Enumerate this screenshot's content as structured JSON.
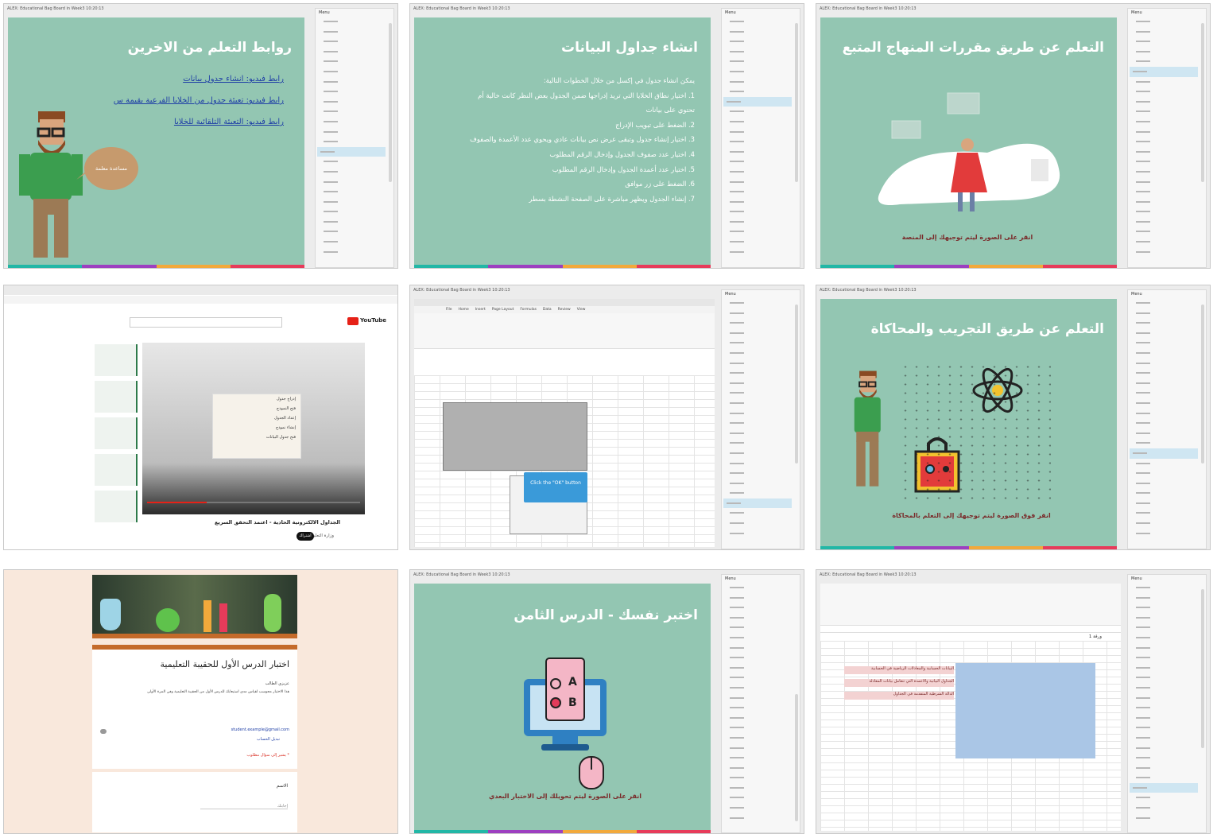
{
  "window_title": "ALEX: Educational Bag Board in Week3 10:20:13",
  "menu_label": "Menu",
  "colors": {
    "slide_bg": "#93c6b2",
    "stripe": [
      "#22b7a6",
      "#9d3fc0",
      "#f2a93b",
      "#e73b5a"
    ],
    "link": "#1f3fa6",
    "caption": "#7a2a2a",
    "sheet_highlight": "#aac6e6",
    "form_bg": "#f9e8dc"
  },
  "tiles": {
    "t1": {
      "title": "روابط التعلم من الاخرين",
      "links": [
        "رابط فيديو: انشاء جدول بيانات",
        "رابط فيديو: تعبئة جدول من الخلايا الفرعية بقيمة س",
        "رابط فيديو: التعبئة التلقائية للخلايا"
      ],
      "bubble": "مساعدة معلمة",
      "icons": [
        "teacher-character-icon",
        "speech-bubble-icon"
      ]
    },
    "t2": {
      "title": "انشاء جداول البيانات",
      "intro": "يمكن انشاء جدول في إكسل من خلال الخطوات التالية:",
      "steps": [
        "1. اختيار نطاق الخلايا التي تريد إدراجها ضمن الجدول بعض النظر كانت خالية أم",
        "تحتوي على بيانات",
        "2. الضغط على تبويب الإدراج",
        "3. اختيار إنشاء جدول وتبقى عرض نص بيانات عادي ويحوي عدد الأعمدة والصفوف",
        "4. اختيار عدد صفوف الجدول وإدخال الرقم المطلوب",
        "5. اختيار عدد أعمدة الجدول وإدخال الرقم المطلوب",
        "6. الضغط على زر موافق",
        "7. إنشاء الجدول ويظهر مباشرة على الصفحة النشطة بسطر"
      ]
    },
    "t3": {
      "title": "التعلم عن طريق مقررات المنهاج المتبع",
      "caption": "انقر على الصورة ليتم توجيهك إلى المنصة",
      "icons": [
        "woman-walking-illustration"
      ]
    },
    "t4": {
      "site": "YouTube",
      "video_title": "الجداول الالكترونية الحادية - اعتمد التحقق السريع",
      "menu_items": [
        "إدراج جدول",
        "فتح النموذج",
        "إعداد الجدول",
        "إنشاء نموذج",
        "فتح جدول البيانات"
      ],
      "channel": "وزارة التعليم",
      "subscribe": "اشتراك"
    },
    "t5": {
      "callout": "Click the \"OK\" button",
      "ribbon_tabs": [
        "File",
        "Home",
        "Insert",
        "Page Layout",
        "Formulas",
        "Data",
        "Review",
        "View"
      ]
    },
    "t6": {
      "title": "التعلم عن طريق التجريب والمحاكاة",
      "caption": "انقر فوق الصورة ليتم توجيهك إلى التعلم بالمحاكاة",
      "icons": [
        "teacher-character-icon",
        "atom-icon",
        "robot-lock-icon"
      ]
    },
    "t7": {
      "form_title": "اختبار الدرس الأول للحقيبة التعليمية",
      "greeting": "عزيزي الطالب",
      "description": "هذا الاختبار محوسب لقياس مدى استيعابك للدرس الأول من الحقيبة التعليمية وفي المرة الأولى",
      "email": "student.example@gmail.com",
      "switch_account": "تبديل الحساب",
      "required_note": "* يشير إلى سؤال مطلوب",
      "name_label": "الاسم",
      "answer_placeholder": "إجابتك"
    },
    "t8": {
      "title": "اختبر نفسك - الدرس الثامن",
      "option_a": "A",
      "option_b": "B",
      "caption": "انقر على الصورة ليتم تحويلك إلى الاختبار البعدي",
      "icons": [
        "exam-computer-icon",
        "mouse-icon"
      ]
    },
    "t9": {
      "sheet_rows": [
        "البيانات الحسابية والمعادلات الرياضية في الحسابية",
        "الجداول البيانية والأعمدة التي تتعامل بيانات المعادلة",
        "الدالة الشرطية المتقدمة في الجداول"
      ],
      "sheet_label": "ورقة 1"
    }
  },
  "menu_items_count": 24
}
